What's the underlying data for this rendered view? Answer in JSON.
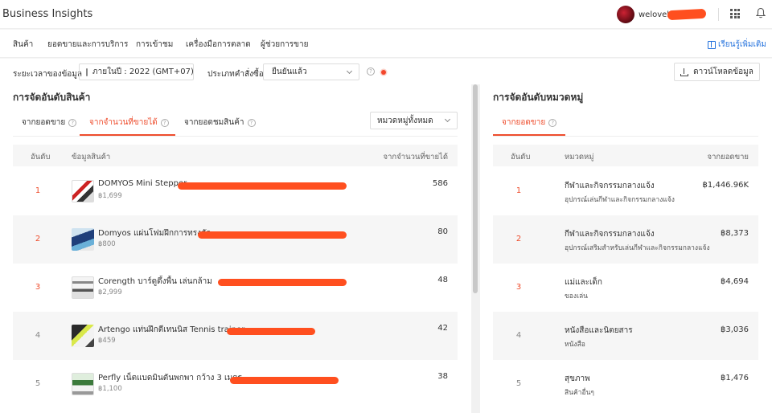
{
  "header": {
    "app_title": "Business Insights",
    "username": "welovel",
    "avatar_text": "WE LOVE"
  },
  "nav": {
    "items": [
      "สินค้า",
      "ยอดขายและการบริการ",
      "การเข้าชม",
      "เครื่องมือการตลาด",
      "ผู้ช่วยการขาย"
    ],
    "learn_more": "เรียนรู้เพิ่มเติม"
  },
  "filters": {
    "period_label": "ระยะเวลาของข้อมูล",
    "period_value": "ภายในปี : 2022 (GMT+07)",
    "order_type_label": "ประเภทคำสั่งซื้อ",
    "order_type_value": "ยืนยันแล้ว",
    "download_label": "ดาวน์โหลดข้อมูล"
  },
  "product_ranking": {
    "title": "การจัดอันดับสินค้า",
    "tabs": [
      "จากยอดขาย",
      "จากจำนวนที่ขายได้",
      "จากยอดชมสินค้า"
    ],
    "active_tab": 1,
    "category_filter": "หมวดหมู่ทั้งหมด",
    "columns": [
      "อันดับ",
      "ข้อมูลสินค้า",
      "จากจำนวนที่ขายได้"
    ],
    "rows": [
      {
        "rank": "1",
        "name": "DOMYOS Mini Stepper",
        "price": "฿1,699",
        "value": "586"
      },
      {
        "rank": "2",
        "name": "Domyos แผ่นโฟมฝึกการทรงตัว",
        "price": "฿800",
        "value": "80"
      },
      {
        "rank": "3",
        "name": "Corength บาร์ดูดึ้งพื้น เล่นกล้าม",
        "price": "฿2,999",
        "value": "48"
      },
      {
        "rank": "4",
        "name": "Artengo แท่นฝึกตีเทนนิส Tennis trainer",
        "price": "฿459",
        "value": "42"
      },
      {
        "rank": "5",
        "name": "Perfly เน็ตแบดมินตันพกพา กว้าง 3 เมตร",
        "price": "฿1,100",
        "value": "38"
      }
    ]
  },
  "category_ranking": {
    "title": "การจัดอันดับหมวดหมู่",
    "tab": "จากยอดขาย",
    "columns": [
      "อันดับ",
      "หมวดหมู่",
      "จากยอดขาย"
    ],
    "rows": [
      {
        "rank": "1",
        "category": "กีฬาและกิจกรรมกลางแจ้ง",
        "sub": "อุปกรณ์เล่นกีฬาและกิจกรรมกลางแจ้ง",
        "value": "฿1,446.96K"
      },
      {
        "rank": "2",
        "category": "กีฬาและกิจกรรมกลางแจ้ง",
        "sub": "อุปกรณ์เสริมสำหรับเล่นกีฬาและกิจกรรมกลางแจ้ง",
        "value": "฿8,373"
      },
      {
        "rank": "3",
        "category": "แม่และเด็ก",
        "sub": "ของเล่น",
        "value": "฿4,694"
      },
      {
        "rank": "4",
        "category": "หนังสือและนิตยสาร",
        "sub": "หนังสือ",
        "value": "฿3,036"
      },
      {
        "rank": "5",
        "category": "สุขภาพ",
        "sub": "สินค้าอื่นๆ",
        "value": "฿1,476"
      }
    ]
  },
  "colors": {
    "accent": "#ee4d2d",
    "link": "#2673dd",
    "redaction": "#ff4f1f"
  },
  "icons": [
    "calendar-icon",
    "chevron-down-icon",
    "help-icon",
    "download-icon",
    "apps-grid-icon",
    "bell-icon",
    "book-icon"
  ]
}
